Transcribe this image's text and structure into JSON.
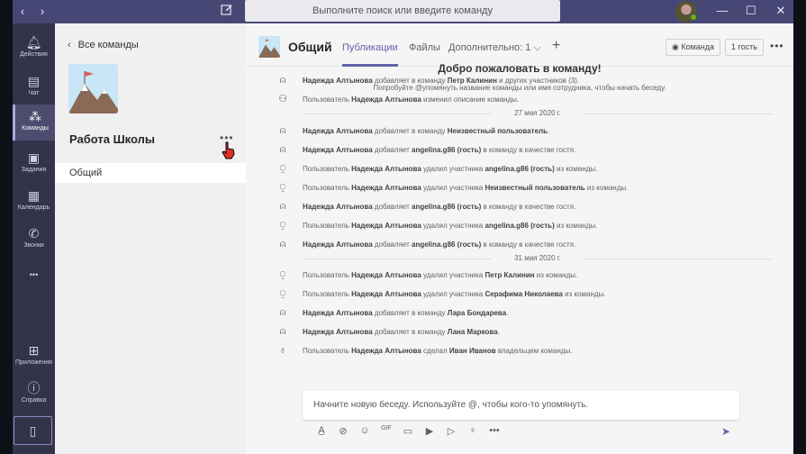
{
  "titlebar": {
    "back_icon": "‹",
    "forward_icon": "›",
    "search_placeholder": "Выполните поиск или введите команду"
  },
  "rail": {
    "items": [
      {
        "label": "Действия",
        "icon": "bell-icon"
      },
      {
        "label": "Чат",
        "icon": "chat-icon"
      },
      {
        "label": "Команды",
        "icon": "teams-icon"
      },
      {
        "label": "Задания",
        "icon": "assignments-icon"
      },
      {
        "label": "Календарь",
        "icon": "calendar-icon"
      },
      {
        "label": "Звонки",
        "icon": "phone-icon"
      },
      {
        "label": "Приложения",
        "icon": "apps-icon"
      },
      {
        "label": "Справка",
        "icon": "help-icon"
      }
    ],
    "more": "•••",
    "active": "Команды"
  },
  "panel": {
    "back_label": "Все команды",
    "team_name": "Работа Школы",
    "more": "•••",
    "channels": [
      "Общий"
    ]
  },
  "header": {
    "title": "Общий",
    "tabs": [
      "Публикации",
      "Файлы",
      "Дополнительно: 1 ⌵"
    ],
    "active_tab": "Публикации",
    "team_button": "Команда",
    "guest_button": "1 гость",
    "more": "•••"
  },
  "feed": {
    "welcome": "Добро пожаловать в команду!",
    "hint": "Попробуйте @упомянуть название команды или имя сотрудника, чтобы начать беседу.",
    "events": [
      {
        "icon": "person-add-icon",
        "parts": [
          [
            "b",
            "Надежда Алтынова"
          ],
          [
            "t",
            " добавляет в команду "
          ],
          [
            "b",
            "Петр Калинин"
          ],
          [
            "t",
            " и других участников (3)."
          ]
        ]
      },
      {
        "icon": "team-edit-icon",
        "parts": [
          [
            "t",
            "Пользователь "
          ],
          [
            "b",
            "Надежда Алтынова"
          ],
          [
            "t",
            " изменил описание команды."
          ]
        ]
      },
      {
        "date": "27 мая 2020 г."
      },
      {
        "icon": "person-add-icon",
        "parts": [
          [
            "b",
            "Надежда Алтынова"
          ],
          [
            "t",
            " добавляет в команду "
          ],
          [
            "b",
            "Неизвестный пользователь"
          ],
          [
            "t",
            "."
          ]
        ]
      },
      {
        "icon": "person-add-icon",
        "parts": [
          [
            "b",
            "Надежда Алтынова"
          ],
          [
            "t",
            " добавляет "
          ],
          [
            "b",
            "angelina.g86 (гость)"
          ],
          [
            "t",
            " в команду в качестве гостя."
          ]
        ]
      },
      {
        "icon": "person-remove-icon",
        "parts": [
          [
            "t",
            "Пользователь "
          ],
          [
            "b",
            "Надежда Алтынова"
          ],
          [
            "t",
            " удалил участника "
          ],
          [
            "b",
            "angelina.g86 (гость)"
          ],
          [
            "t",
            " из команды."
          ]
        ]
      },
      {
        "icon": "person-remove-icon",
        "parts": [
          [
            "t",
            "Пользователь "
          ],
          [
            "b",
            "Надежда Алтынова"
          ],
          [
            "t",
            " удалил участника "
          ],
          [
            "b",
            "Неизвестный пользователь"
          ],
          [
            "t",
            " из команды."
          ]
        ]
      },
      {
        "icon": "person-add-icon",
        "parts": [
          [
            "b",
            "Надежда Алтынова"
          ],
          [
            "t",
            " добавляет "
          ],
          [
            "b",
            "angelina.g86 (гость)"
          ],
          [
            "t",
            " в команду в качестве гостя."
          ]
        ]
      },
      {
        "icon": "person-remove-icon",
        "parts": [
          [
            "t",
            "Пользователь "
          ],
          [
            "b",
            "Надежда Алтынова"
          ],
          [
            "t",
            " удалил участника "
          ],
          [
            "b",
            "angelina.g86 (гость)"
          ],
          [
            "t",
            " из команды."
          ]
        ]
      },
      {
        "icon": "person-add-icon",
        "parts": [
          [
            "b",
            "Надежда Алтынова"
          ],
          [
            "t",
            " добавляет "
          ],
          [
            "b",
            "angelina.g86 (гость)"
          ],
          [
            "t",
            " в команду в качестве гостя."
          ]
        ]
      },
      {
        "date": "31 мая 2020 г."
      },
      {
        "icon": "person-remove-icon",
        "parts": [
          [
            "t",
            "Пользователь "
          ],
          [
            "b",
            "Надежда Алтынова"
          ],
          [
            "t",
            " удалил участника "
          ],
          [
            "b",
            "Петр Калинин"
          ],
          [
            "t",
            " из команды."
          ]
        ]
      },
      {
        "icon": "person-remove-icon",
        "parts": [
          [
            "t",
            "Пользователь "
          ],
          [
            "b",
            "Надежда Алтынова"
          ],
          [
            "t",
            " удалил участника "
          ],
          [
            "b",
            "Серафима Николаева"
          ],
          [
            "t",
            " из команды."
          ]
        ]
      },
      {
        "icon": "person-add-icon",
        "parts": [
          [
            "b",
            "Надежда Алтынова"
          ],
          [
            "t",
            " добавляет в команду "
          ],
          [
            "b",
            "Лара Бондарева"
          ],
          [
            "t",
            "."
          ]
        ]
      },
      {
        "icon": "person-add-icon",
        "parts": [
          [
            "b",
            "Надежда Алтынова"
          ],
          [
            "t",
            " добавляет в команду "
          ],
          [
            "b",
            "Лана Маркова"
          ],
          [
            "t",
            "."
          ]
        ]
      },
      {
        "icon": "owner-icon",
        "parts": [
          [
            "t",
            "Пользователь "
          ],
          [
            "b",
            "Надежда Алтынова"
          ],
          [
            "t",
            " сделал "
          ],
          [
            "b",
            "Иван Иванов"
          ],
          [
            "t",
            " владельцем команды."
          ]
        ]
      }
    ]
  },
  "compose": {
    "placeholder": "Начните новую беседу. Используйте @, чтобы кого-то упомянуть."
  },
  "colors": {
    "brand": "#6264a7",
    "titlebar": "#464775",
    "rail": "#33344a"
  }
}
